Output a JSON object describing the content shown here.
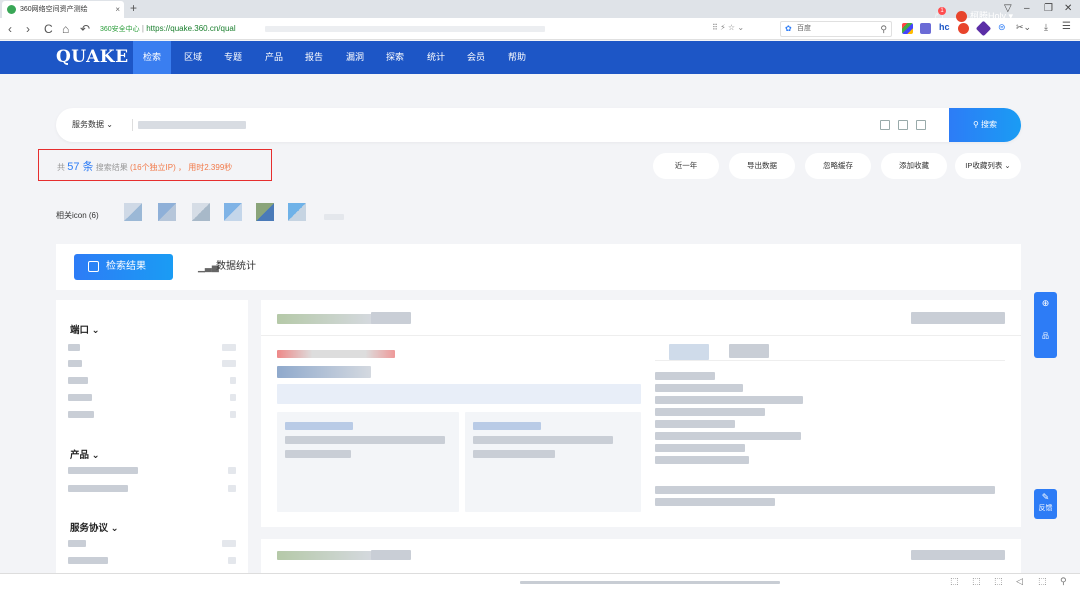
{
  "browser": {
    "tab_title": "360网络空间资产测绘",
    "tab_close": "×",
    "new_tab": "+",
    "nav": {
      "back": "‹",
      "forward": "›",
      "reload": "C",
      "home": "⌂",
      "undo": "↶"
    },
    "safe_label": "360安全中心",
    "url": "https://quake.360.cn/qual",
    "search_engine": "百度",
    "ext_hc": "hc",
    "window_controls": [
      "▽",
      "–",
      "❐",
      "✕"
    ]
  },
  "site": {
    "logo": "QUAKE",
    "nav": [
      "检索",
      "区域",
      "专题",
      "产品",
      "报告",
      "漏洞",
      "探索",
      "统计",
      "会员",
      "帮助"
    ],
    "active_nav": "检索",
    "notification_count": "1",
    "user": "柯腾Holy ▾",
    "colors": {
      "header": "#1d56c6",
      "accent": "#2d7cf6",
      "highlight": "#e62e2e"
    }
  },
  "search": {
    "scope": "服务数据 ⌄",
    "button": "⚲ 搜索"
  },
  "summary": {
    "prefix": "共",
    "count": "57 条",
    "label": "搜索结果",
    "ip_count": "(16个独立IP)",
    "separator": "，",
    "time": "用时2.399秒"
  },
  "actions": [
    "近一年",
    "导出数据",
    "忽略缓存",
    "添加收藏",
    "IP收藏列表 ⌄"
  ],
  "related": {
    "label": "相关icon (6)"
  },
  "tabs": {
    "results": "检索结果",
    "stats": "数据统计"
  },
  "filters": [
    {
      "title": "端口 ⌄"
    },
    {
      "title": "产品 ⌄"
    },
    {
      "title": "服务协议 ⌄"
    }
  ],
  "floating": {
    "top": "品",
    "feedback": "反馈"
  }
}
